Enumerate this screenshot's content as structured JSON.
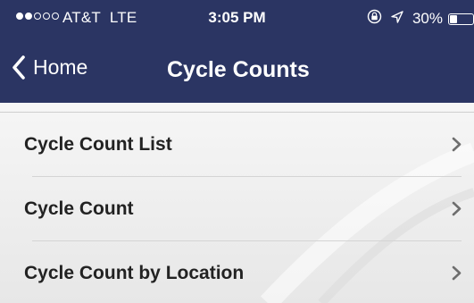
{
  "status_bar": {
    "carrier": "AT&T",
    "network": "LTE",
    "time": "3:05 PM",
    "battery": "30%",
    "battery_level": 0.3,
    "signal_bars_filled": 2,
    "signal_bars_total": 5,
    "icons": [
      "orientation-lock-icon",
      "location-arrow-icon",
      "battery-icon"
    ]
  },
  "nav": {
    "back_label": "Home",
    "title": "Cycle Counts"
  },
  "menu": {
    "items": [
      {
        "label": "Cycle Count List"
      },
      {
        "label": "Cycle Count"
      },
      {
        "label": "Cycle Count by Location"
      }
    ]
  },
  "colors": {
    "header_bg": "#2b3563",
    "header_text": "#ffffff",
    "list_bg": "#eeeeee",
    "item_text": "#222222",
    "chevron": "#6e6e6e"
  }
}
